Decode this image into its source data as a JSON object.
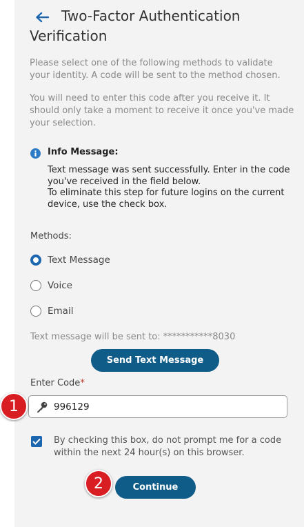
{
  "header": {
    "title_line1": "Two-Factor Authentication",
    "title_line2": "Verification"
  },
  "intro": {
    "paragraph1": "Please select one of the following methods to validate your identity. A code will be sent to the method chosen.",
    "paragraph2": "You will need to enter this code after you receive it. It should only take a moment to receive it once you've made your selection."
  },
  "info": {
    "title": "Info Message:",
    "line1": "Text message was sent successfully. Enter in the code you've received in the field below.",
    "line2": "To eliminate this step for future logins on the current device, use the check box."
  },
  "methods": {
    "label": "Methods:",
    "options": [
      {
        "label": "Text Message",
        "selected": true
      },
      {
        "label": "Voice",
        "selected": false
      },
      {
        "label": "Email",
        "selected": false
      }
    ]
  },
  "sent_to": "Text message will be sent to: ***********8030",
  "send_button": "Send Text Message",
  "code": {
    "label": "Enter Code",
    "required_mark": "*",
    "value": "996129"
  },
  "remember": {
    "checked": true,
    "text": "By checking this box, do not prompt me for a code within the next 24 hour(s) on this browser."
  },
  "continue_button": "Continue",
  "markers": {
    "step1": "1",
    "step2": "2"
  },
  "colors": {
    "primary_button": "#0f5c88",
    "accent": "#1c66b0",
    "marker": "#d81e22",
    "panel": "#f3f3f3"
  },
  "icons": {
    "back": "arrow-left-icon",
    "info": "info-icon",
    "key": "key-icon",
    "check": "checkmark-icon"
  }
}
